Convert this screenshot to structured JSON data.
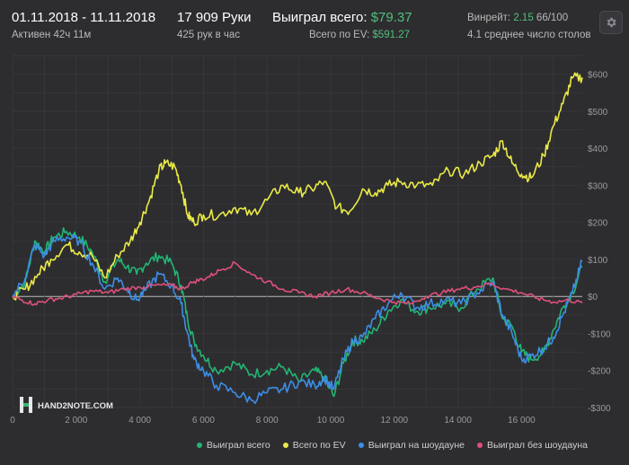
{
  "header": {
    "date_range": "01.11.2018 - 11.11.2018",
    "active_time": "Активен 42ч 11м",
    "hands": "17 909 Руки",
    "hands_per_hour": "425 рук в час",
    "won_total_label": "Выиграл всего:",
    "won_total_value": "$79.37",
    "ev_label": "Всего по EV:",
    "ev_value": "$591.27",
    "winrate_label": "Винрейт:",
    "winrate_value": "2.15",
    "winrate_suffix": "66/100",
    "tables": "4.1 среднее число столов"
  },
  "logo_text": "HAND2NOTE.COM",
  "colors": {
    "won_total": "#22b573",
    "ev": "#eaea47",
    "showdown": "#3d8ee6",
    "no_showdown": "#e0507a",
    "background": "#2d2d30",
    "grid": "#3a3a3e",
    "zero_line": "#bbbbbb"
  },
  "chart_data": {
    "type": "line",
    "xlim": [
      0,
      17909
    ],
    "ylim": [
      -300,
      650
    ],
    "x_ticks": [
      0,
      2000,
      4000,
      6000,
      8000,
      10000,
      12000,
      14000,
      16000
    ],
    "x_tick_labels": [
      "0",
      "2 000",
      "4 000",
      "6 000",
      "8 000",
      "10 000",
      "12 000",
      "14 000",
      "16 000"
    ],
    "y_ticks": [
      600,
      500,
      400,
      300,
      200,
      100,
      0,
      -100,
      -200,
      -300
    ],
    "y_tick_labels": [
      "$600",
      "$500",
      "$400",
      "$300",
      "$200",
      "$100",
      "$0",
      "-$100",
      "-$200",
      "-$300"
    ],
    "series": [
      {
        "name": "Выиграл всего",
        "color": "#22b573",
        "points": [
          [
            0,
            0
          ],
          [
            400,
            40
          ],
          [
            700,
            150
          ],
          [
            1000,
            120
          ],
          [
            1300,
            160
          ],
          [
            1700,
            175
          ],
          [
            2100,
            160
          ],
          [
            2500,
            120
          ],
          [
            2900,
            40
          ],
          [
            3300,
            100
          ],
          [
            3600,
            80
          ],
          [
            3900,
            60
          ],
          [
            4200,
            90
          ],
          [
            4600,
            110
          ],
          [
            5000,
            90
          ],
          [
            5300,
            30
          ],
          [
            5500,
            -60
          ],
          [
            5700,
            -120
          ],
          [
            6000,
            -160
          ],
          [
            6400,
            -200
          ],
          [
            7000,
            -180
          ],
          [
            7500,
            -210
          ],
          [
            8000,
            -200
          ],
          [
            8500,
            -190
          ],
          [
            9000,
            -230
          ],
          [
            9500,
            -200
          ],
          [
            9800,
            -220
          ],
          [
            10100,
            -270
          ],
          [
            10400,
            -180
          ],
          [
            10700,
            -120
          ],
          [
            11000,
            -120
          ],
          [
            11400,
            -90
          ],
          [
            11800,
            -40
          ],
          [
            12200,
            -10
          ],
          [
            12700,
            -40
          ],
          [
            13100,
            -30
          ],
          [
            13600,
            -20
          ],
          [
            14100,
            -30
          ],
          [
            14600,
            20
          ],
          [
            15100,
            50
          ],
          [
            15400,
            -60
          ],
          [
            15700,
            -80
          ],
          [
            16000,
            -150
          ],
          [
            16300,
            -170
          ],
          [
            16700,
            -150
          ],
          [
            17000,
            -90
          ],
          [
            17300,
            -30
          ],
          [
            17600,
            10
          ],
          [
            17909,
            79
          ]
        ]
      },
      {
        "name": "Всего по EV",
        "color": "#eaea47",
        "points": [
          [
            0,
            0
          ],
          [
            400,
            20
          ],
          [
            800,
            60
          ],
          [
            1200,
            100
          ],
          [
            1700,
            140
          ],
          [
            2100,
            120
          ],
          [
            2500,
            110
          ],
          [
            2900,
            50
          ],
          [
            3300,
            110
          ],
          [
            3700,
            150
          ],
          [
            4000,
            200
          ],
          [
            4300,
            260
          ],
          [
            4600,
            340
          ],
          [
            4800,
            360
          ],
          [
            5100,
            350
          ],
          [
            5300,
            300
          ],
          [
            5500,
            220
          ],
          [
            5700,
            200
          ],
          [
            6000,
            220
          ],
          [
            6500,
            220
          ],
          [
            7000,
            240
          ],
          [
            7500,
            220
          ],
          [
            8000,
            260
          ],
          [
            8500,
            300
          ],
          [
            9000,
            280
          ],
          [
            9400,
            290
          ],
          [
            9800,
            310
          ],
          [
            10200,
            240
          ],
          [
            10600,
            230
          ],
          [
            11000,
            290
          ],
          [
            11400,
            280
          ],
          [
            11800,
            300
          ],
          [
            12200,
            310
          ],
          [
            12700,
            300
          ],
          [
            13200,
            300
          ],
          [
            13700,
            340
          ],
          [
            14200,
            330
          ],
          [
            14700,
            360
          ],
          [
            15100,
            380
          ],
          [
            15400,
            420
          ],
          [
            15700,
            360
          ],
          [
            16000,
            330
          ],
          [
            16300,
            320
          ],
          [
            16700,
            380
          ],
          [
            17000,
            460
          ],
          [
            17300,
            520
          ],
          [
            17600,
            590
          ],
          [
            17909,
            591
          ]
        ]
      },
      {
        "name": "Выиграл на шоудауне",
        "color": "#3d8ee6",
        "points": [
          [
            0,
            0
          ],
          [
            400,
            50
          ],
          [
            700,
            140
          ],
          [
            1000,
            110
          ],
          [
            1300,
            150
          ],
          [
            1700,
            160
          ],
          [
            2100,
            150
          ],
          [
            2500,
            90
          ],
          [
            2900,
            20
          ],
          [
            3300,
            50
          ],
          [
            3600,
            20
          ],
          [
            3900,
            -10
          ],
          [
            4200,
            20
          ],
          [
            4600,
            60
          ],
          [
            5000,
            30
          ],
          [
            5300,
            -20
          ],
          [
            5500,
            -100
          ],
          [
            5700,
            -170
          ],
          [
            6000,
            -200
          ],
          [
            6400,
            -240
          ],
          [
            7000,
            -260
          ],
          [
            7500,
            -280
          ],
          [
            8000,
            -260
          ],
          [
            8500,
            -250
          ],
          [
            9000,
            -230
          ],
          [
            9500,
            -240
          ],
          [
            9800,
            -220
          ],
          [
            10100,
            -250
          ],
          [
            10400,
            -170
          ],
          [
            10700,
            -120
          ],
          [
            11000,
            -110
          ],
          [
            11400,
            -60
          ],
          [
            11800,
            -20
          ],
          [
            12200,
            10
          ],
          [
            12700,
            -30
          ],
          [
            13100,
            -20
          ],
          [
            13600,
            -10
          ],
          [
            14100,
            -20
          ],
          [
            14600,
            10
          ],
          [
            15100,
            40
          ],
          [
            15400,
            -50
          ],
          [
            15700,
            -100
          ],
          [
            16000,
            -170
          ],
          [
            16300,
            -160
          ],
          [
            16700,
            -140
          ],
          [
            17000,
            -110
          ],
          [
            17300,
            -50
          ],
          [
            17600,
            10
          ],
          [
            17909,
            95
          ]
        ]
      },
      {
        "name": "Выиграл без шоудауна",
        "color": "#e0507a",
        "points": [
          [
            0,
            0
          ],
          [
            300,
            -10
          ],
          [
            700,
            -20
          ],
          [
            1100,
            -10
          ],
          [
            1500,
            -5
          ],
          [
            2000,
            5
          ],
          [
            2500,
            15
          ],
          [
            3000,
            10
          ],
          [
            3500,
            20
          ],
          [
            4000,
            25
          ],
          [
            4500,
            30
          ],
          [
            5000,
            30
          ],
          [
            5300,
            20
          ],
          [
            5700,
            40
          ],
          [
            6100,
            50
          ],
          [
            6500,
            70
          ],
          [
            7000,
            90
          ],
          [
            7500,
            60
          ],
          [
            8000,
            40
          ],
          [
            8500,
            20
          ],
          [
            9000,
            10
          ],
          [
            9500,
            0
          ],
          [
            10000,
            10
          ],
          [
            10500,
            20
          ],
          [
            11000,
            10
          ],
          [
            11500,
            -5
          ],
          [
            12000,
            -15
          ],
          [
            12500,
            -20
          ],
          [
            13000,
            0
          ],
          [
            13500,
            10
          ],
          [
            14000,
            20
          ],
          [
            14500,
            25
          ],
          [
            15000,
            35
          ],
          [
            15500,
            20
          ],
          [
            16000,
            10
          ],
          [
            16500,
            -5
          ],
          [
            17000,
            -15
          ],
          [
            17500,
            -10
          ],
          [
            17909,
            -18
          ]
        ]
      }
    ]
  }
}
